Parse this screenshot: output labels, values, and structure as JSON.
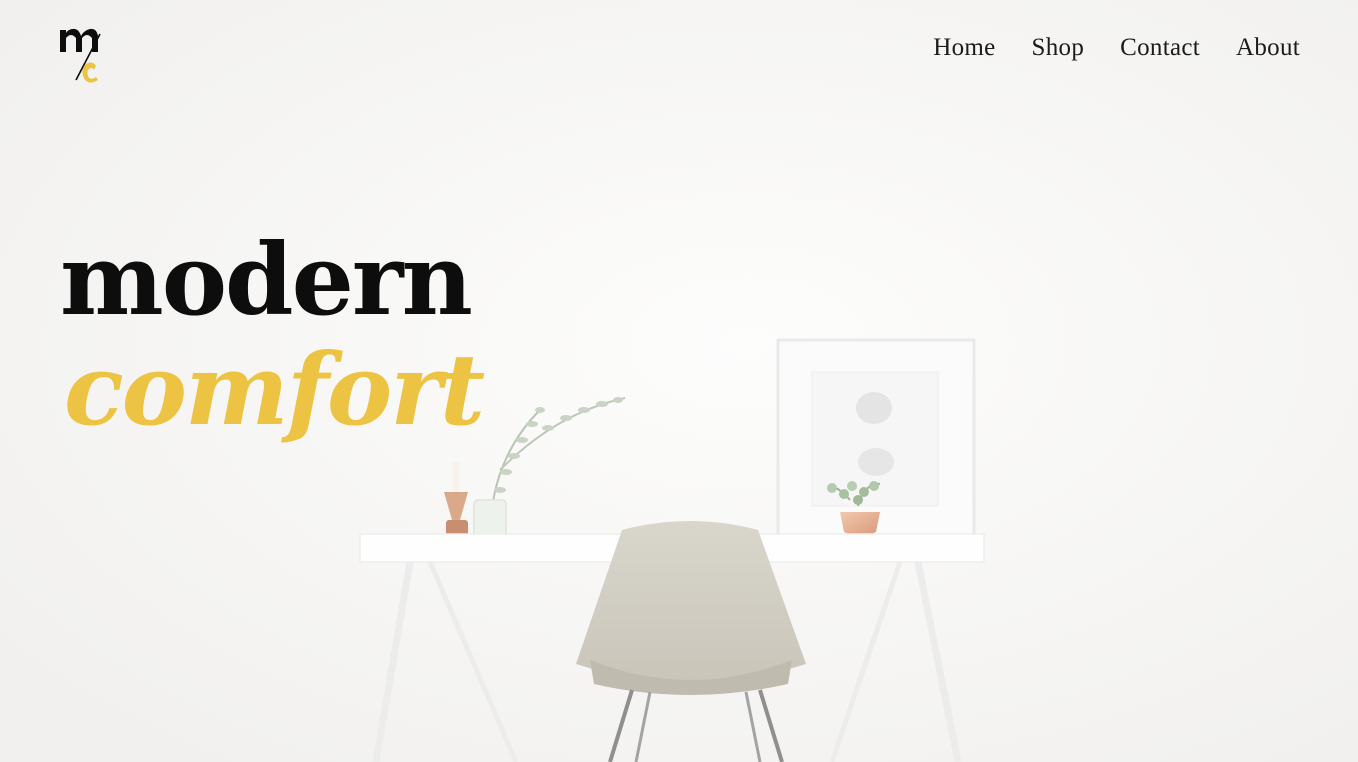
{
  "brand": {
    "logo_text": "mc",
    "accent_color": "#ecc342",
    "text_color": "#0d0d0d"
  },
  "nav": {
    "items": [
      {
        "label": "Home"
      },
      {
        "label": "Shop"
      },
      {
        "label": "Contact"
      },
      {
        "label": "About"
      }
    ]
  },
  "hero": {
    "title_line1": "modern",
    "title_line2": "comfort",
    "image": {
      "description_icons": [
        "white-desk",
        "beige-chair",
        "picture-frame",
        "plant-pot",
        "vase",
        "candle-holder"
      ],
      "background_color": "#f8f7f6"
    }
  }
}
